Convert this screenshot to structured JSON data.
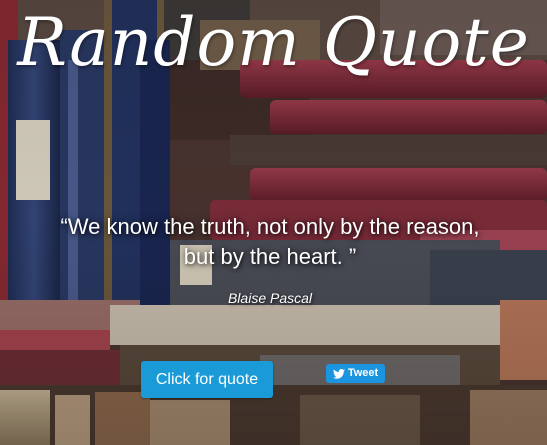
{
  "header": {
    "title": "Random Quote"
  },
  "quote": {
    "text": "“We know the truth, not only by the reason, but by the heart. ”",
    "author": "Blaise Pascal"
  },
  "actions": {
    "quote_button_label": "Click for quote",
    "tweet_button_label": "Tweet",
    "tweet_icon": "twitter-bird-icon"
  },
  "colors": {
    "primary_button": "#1b9ad8",
    "tweet_button": "#1b95e0",
    "text": "#ffffff"
  },
  "background": {
    "image_subject": "stack of old books"
  }
}
